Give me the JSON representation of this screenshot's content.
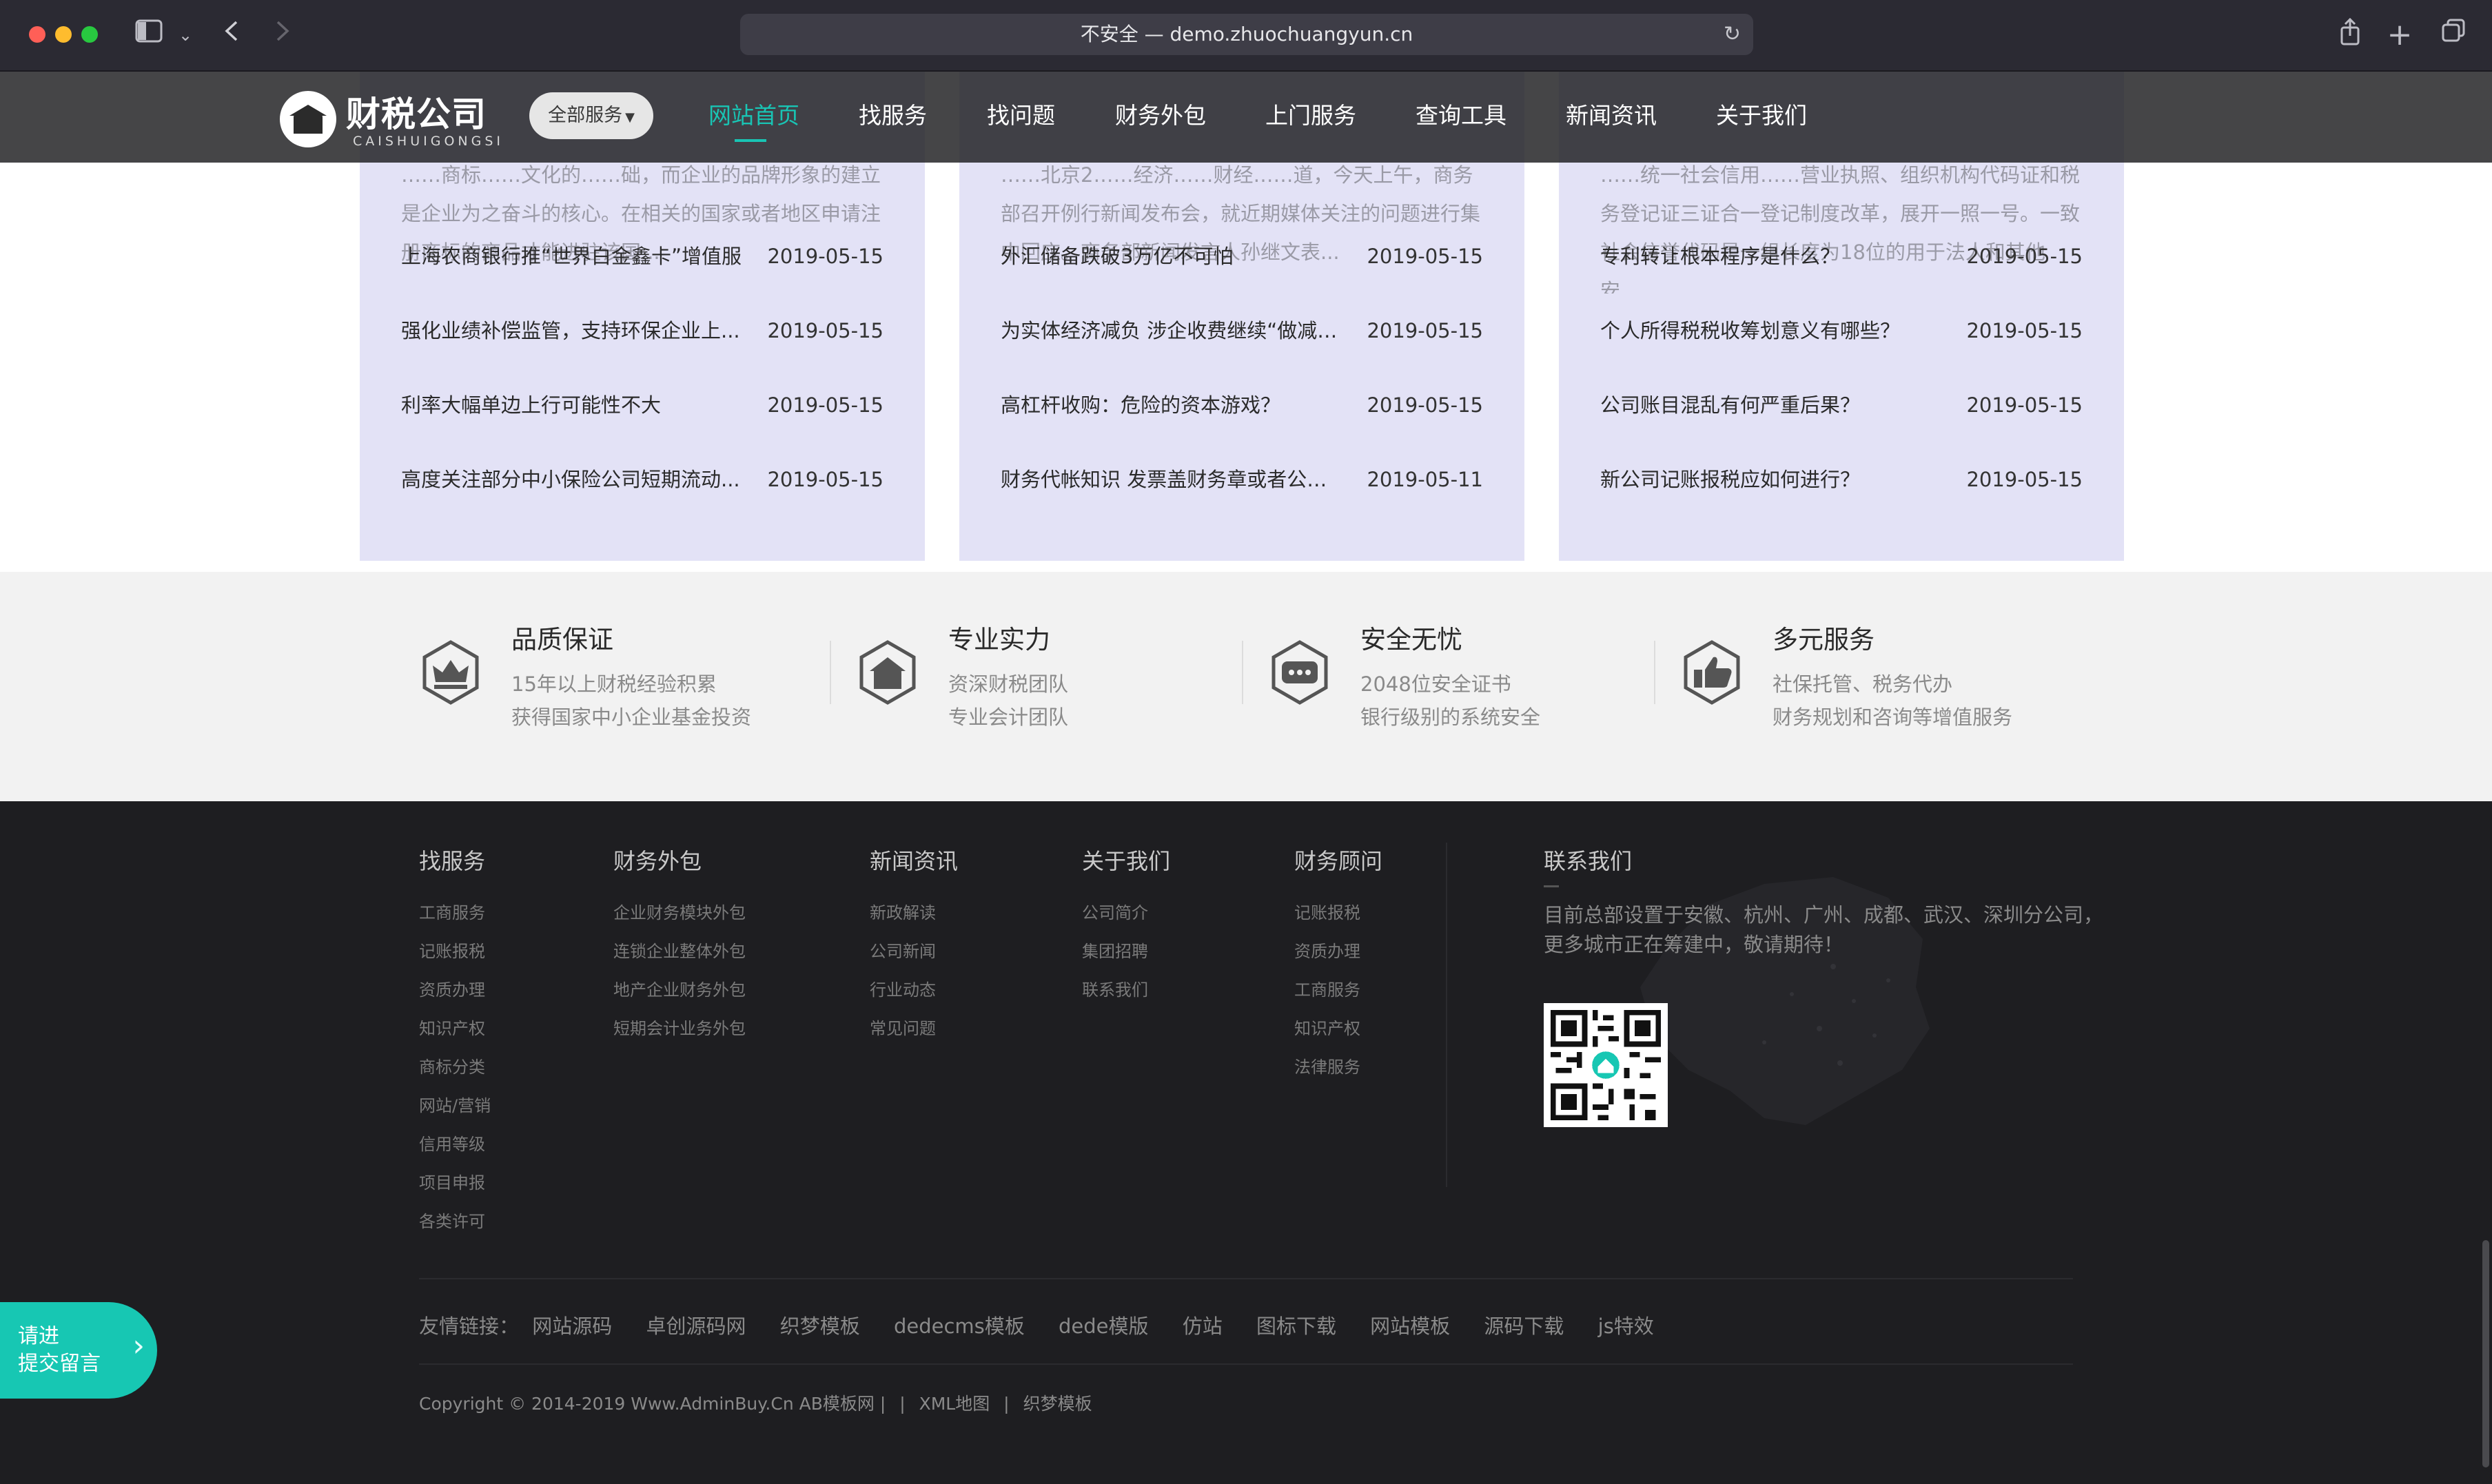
{
  "browser": {
    "url": "不安全 — demo.zhuochuangyun.cn",
    "reload_icon": "reload-icon",
    "share_icon": "share-icon",
    "new_tab_icon": "plus-icon",
    "tabs_icon": "tabs-overview-icon",
    "back_icon": "chevron-left-icon",
    "forward_icon": "chevron-right-icon",
    "sidebar_icon": "sidebar-icon"
  },
  "header": {
    "logo_cn": "财税公司",
    "logo_en": "CAISHUIGONGSI",
    "all_services": "全部服务",
    "nav": [
      "网站首页",
      "找服务",
      "找问题",
      "财务外包",
      "上门服务",
      "查询工具",
      "新闻资讯",
      "关于我们"
    ],
    "active_color": "#19c4b4"
  },
  "news": [
    {
      "intro": "……商标……文化的……础，而企业的品牌形象的建立是企业为之奋斗的核心。在相关的国家或者地区申请注册商标的商品才能进驻该国...",
      "items": [
        {
          "title": "上海农商银行推“世界白金鑫卡”增值服",
          "date": "2019-05-15"
        },
        {
          "title": "强化业绩补偿监管，支持环保企业上...",
          "date": "2019-05-15"
        },
        {
          "title": "利率大幅单边上行可能性不大",
          "date": "2019-05-15"
        },
        {
          "title": "高度关注部分中小保险公司短期流动...",
          "date": "2019-05-15"
        }
      ]
    },
    {
      "intro": "……北京2……经济……财经……道，今天上午，商务部召开例行新闻发布会，就近期媒体关注的问题进行集中回应。商务部新闻发言人孙继文表...",
      "items": [
        {
          "title": "外汇储备跌破3万亿不可怕",
          "date": "2019-05-15"
        },
        {
          "title": "为实体经济减负 涉企收费继续“做减法”",
          "date": "2019-05-15"
        },
        {
          "title": "高杠杆收购：危险的资本游戏？",
          "date": "2019-05-15"
        },
        {
          "title": "财务代帐知识 发票盖财务章或者公章...",
          "date": "2019-05-11"
        }
      ]
    },
    {
      "intro": "……统一社会信用……营业执照、组织机构代码证和税务登记证三证合一登记制度改革，展开一照一号。一致社会信誉代码是一组长度为18位的用于法人和其他安...",
      "items": [
        {
          "title": "专利转让根本程序是什么？",
          "date": "2019-05-15"
        },
        {
          "title": "个人所得税税收筹划意义有哪些？",
          "date": "2019-05-15"
        },
        {
          "title": "公司账目混乱有何严重后果？",
          "date": "2019-05-15"
        },
        {
          "title": "新公司记账报税应如何进行？",
          "date": "2019-05-15"
        }
      ]
    }
  ],
  "features": [
    {
      "title": "品质保证",
      "line1": "15年以上财税经验积累",
      "line2": "获得国家中小企业基金投资",
      "icon": "crown-shield-icon"
    },
    {
      "title": "专业实力",
      "line1": "资深财税团队",
      "line2": "专业会计团队",
      "icon": "house-shield-icon"
    },
    {
      "title": "安全无忧",
      "line1": "2048位安全证书",
      "line2": "银行级别的系统安全",
      "icon": "chat-shield-icon"
    },
    {
      "title": "多元服务",
      "line1": "社保托管、税务代办",
      "line2": "财务规划和咨询等增值服务",
      "icon": "thumbs-up-shield-icon"
    }
  ],
  "footer": {
    "columns": [
      {
        "title": "找服务",
        "links": [
          "工商服务",
          "记账报税",
          "资质办理",
          "知识产权",
          "商标分类",
          "网站/营销",
          "信用等级",
          "项目申报",
          "各类许可"
        ]
      },
      {
        "title": "财务外包",
        "links": [
          "企业财务模块外包",
          "连锁企业整体外包",
          "地产企业财务外包",
          "短期会计业务外包"
        ]
      },
      {
        "title": "新闻资讯",
        "links": [
          "新政解读",
          "公司新闻",
          "行业动态",
          "常见问题"
        ]
      },
      {
        "title": "关于我们",
        "links": [
          "公司简介",
          "集团招聘",
          "联系我们"
        ]
      },
      {
        "title": "财务顾问",
        "links": [
          "记账报税",
          "资质办理",
          "工商服务",
          "知识产权",
          "法律服务"
        ]
      }
    ],
    "contact_title": "联系我们",
    "contact_text": "目前总部设置于安徽、杭州、广州、成都、武汉、深圳分公司，更多城市正在筹建中，敬请期待！",
    "friends_label": "友情链接：",
    "friends": [
      "网站源码",
      "卓创源码网",
      "织梦模板",
      "dedecms模板",
      "dede模版",
      "仿站",
      "图标下载",
      "网站模板",
      "源码下载",
      "js特效"
    ],
    "copyright": "Copyright © 2014-2019 Www.AdminBuy.Cn AB模板网 |",
    "copy_links": [
      "XML地图",
      "织梦模板"
    ],
    "copy_sep": "|"
  },
  "float_button": {
    "line1": "请进",
    "line2": "提交留言"
  }
}
